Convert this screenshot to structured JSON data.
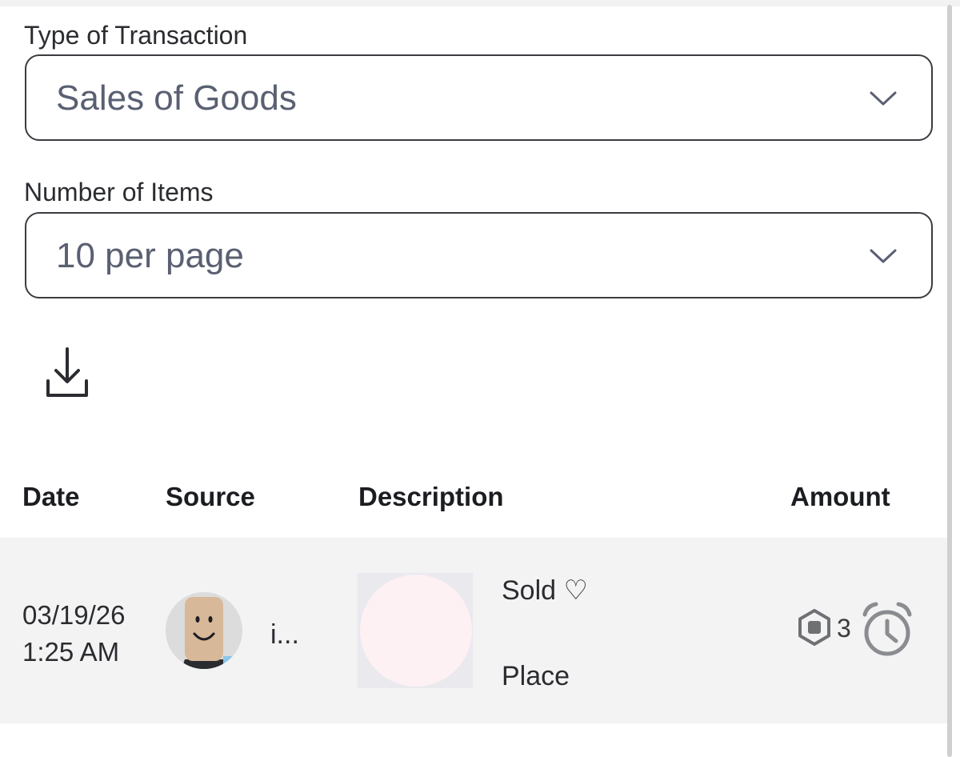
{
  "filters": {
    "transaction_type": {
      "label": "Type of Transaction",
      "value": "Sales of Goods"
    },
    "items_per_page": {
      "label": "Number of Items",
      "value": "10 per page"
    }
  },
  "toolbar": {
    "download_icon": "download-icon"
  },
  "table": {
    "headers": {
      "date": "Date",
      "source": "Source",
      "description": "Description",
      "amount": "Amount"
    },
    "rows": [
      {
        "date": "03/19/26",
        "time": "1:25 AM",
        "source_name": "i...",
        "source_avatar": "avatar-icon",
        "description_line1": "Sold ♡",
        "description_line2": "Place",
        "currency_icon": "robux-icon",
        "amount": "3",
        "status_icon": "pending-clock-icon"
      }
    ]
  },
  "colors": {
    "row_background": "#f3f3f4",
    "border": "#3a3c40",
    "select_text": "#5a6072",
    "icon_gray": "#8a8c90"
  }
}
